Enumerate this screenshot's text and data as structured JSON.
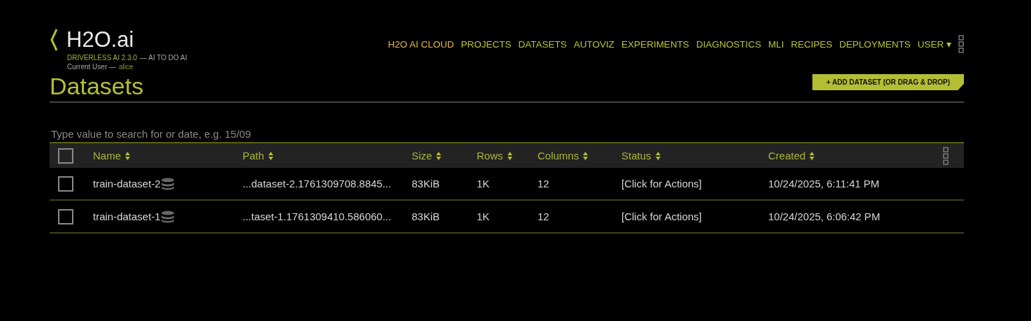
{
  "brand": {
    "logo": "H2O.ai",
    "product": "DRIVERLESS AI 2.3.0",
    "tagline": "— AI TO DO AI",
    "user_label": "Current User —",
    "user": "alice"
  },
  "nav": [
    {
      "label": "H2O AI CLOUD",
      "color": "#e3b94c"
    },
    {
      "label": "PROJECTS",
      "color": "#b9c33a"
    },
    {
      "label": "DATASETS",
      "color": "#b9c33a"
    },
    {
      "label": "AUTOVIZ",
      "color": "#b9c33a"
    },
    {
      "label": "EXPERIMENTS",
      "color": "#b9c33a"
    },
    {
      "label": "DIAGNOSTICS",
      "color": "#b9c33a"
    },
    {
      "label": "MLI",
      "color": "#b9c33a"
    },
    {
      "label": "RECIPES",
      "color": "#b9c33a"
    },
    {
      "label": "DEPLOYMENTS",
      "color": "#b9c33a"
    },
    {
      "label": "USER ▾",
      "color": "#b9c33a"
    }
  ],
  "page_title": "Datasets",
  "add_button": "+ ADD DATASET (OR DRAG & DROP)",
  "search": {
    "placeholder": "Type value to search for or date, e.g. 15/09"
  },
  "table": {
    "select_all": {
      "checked": false
    },
    "columns": [
      "Name",
      "Path",
      "Size",
      "Rows",
      "Columns",
      "Status",
      "Created"
    ],
    "rows": [
      {
        "checked": false,
        "cells": [
          "train-dataset-2",
          "...dataset-2.1761309708.8845...",
          "83KiB",
          "1K",
          "12",
          "[Click for Actions]",
          "10/24/2025, 6:11:41 PM"
        ]
      },
      {
        "checked": false,
        "cells": [
          "train-dataset-1",
          "...taset-1.1761309410.586060...",
          "83KiB",
          "1K",
          "12",
          "[Click for Actions]",
          "10/24/2025, 6:06:42 PM"
        ]
      }
    ]
  }
}
